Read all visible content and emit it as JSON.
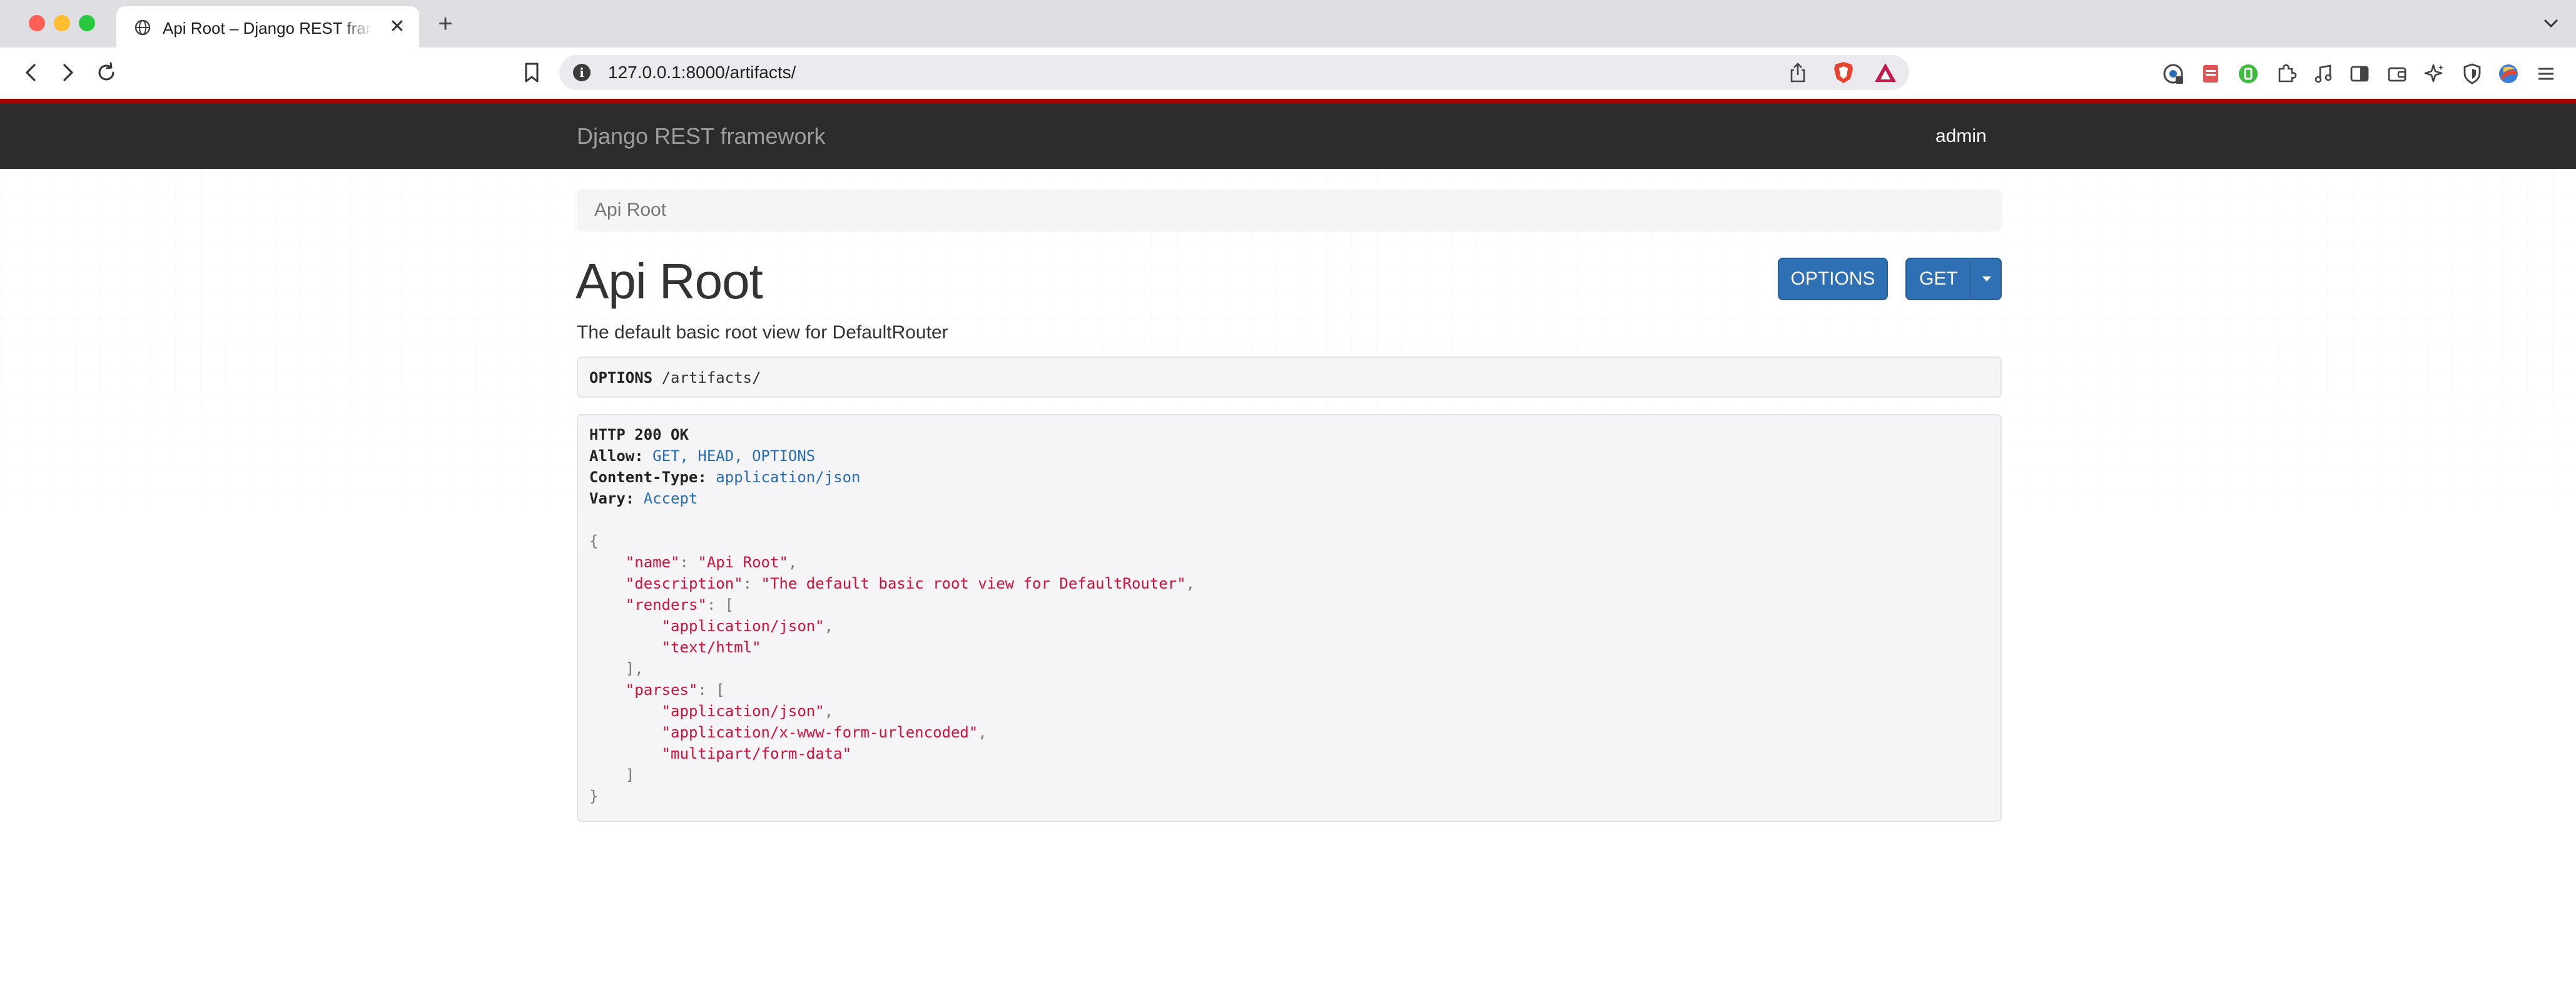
{
  "browser": {
    "tab_title": "Api Root – Django REST framework",
    "new_tab_label": "+",
    "close_label": "✕",
    "url": "127.0.0.1:8000/artifacts/",
    "url_info_label": "i",
    "colors": {
      "tabstrip": "#dedee3",
      "urlbar": "#ebebef",
      "close": "#ff5f57",
      "minimize": "#febc2e",
      "maximize": "#28c840"
    },
    "extension_icons": [
      "extension-badge-icon",
      "pdf-extension-icon",
      "green-extension-icon",
      "puzzle-icon",
      "music-icon",
      "sidebar-icon",
      "wallet-icon",
      "leo-ai-icon",
      "vpn-shield-icon",
      "profile-avatar-icon",
      "menu-icon"
    ]
  },
  "navbar": {
    "brand": "Django REST framework",
    "user": "admin",
    "accent_color": "#a30000",
    "background": "#2c2c2c"
  },
  "breadcrumb": {
    "items": [
      "Api Root"
    ]
  },
  "content": {
    "title": "Api Root",
    "description": "The default basic root view for DefaultRouter",
    "buttons": {
      "options": "OPTIONS",
      "get": "GET"
    },
    "button_color": "#2f6fb4"
  },
  "request": {
    "method": "OPTIONS",
    "path": "/artifacts/"
  },
  "response": {
    "status": "HTTP 200 OK",
    "headers": [
      {
        "name": "Allow:",
        "value": "GET, HEAD, OPTIONS"
      },
      {
        "name": "Content-Type:",
        "value": "application/json"
      },
      {
        "name": "Vary:",
        "value": "Accept"
      }
    ],
    "body": {
      "name": "Api Root",
      "description": "The default basic root view for DefaultRouter",
      "renders": [
        "application/json",
        "text/html"
      ],
      "parses": [
        "application/json",
        "application/x-www-form-urlencoded",
        "multipart/form-data"
      ]
    }
  }
}
